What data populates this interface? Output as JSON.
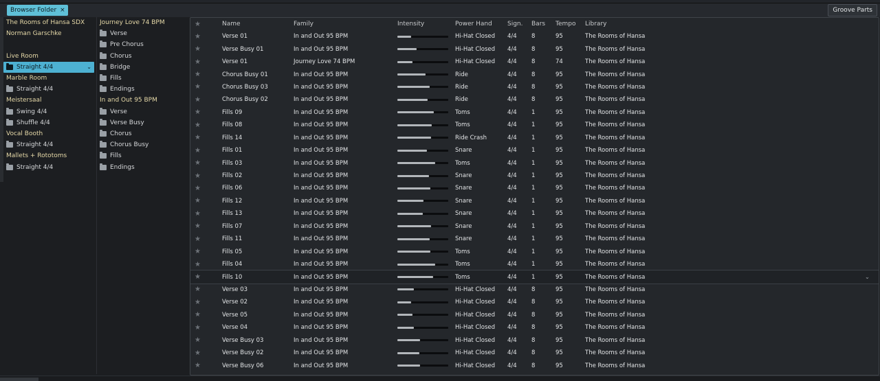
{
  "topbar": {
    "chip_label": "Browser Folder",
    "chip_close": "×",
    "groove_button": "Groove Parts"
  },
  "left_tree": [
    {
      "type": "head",
      "label": "The Rooms of Hansa SDX"
    },
    {
      "type": "head",
      "label": "Norman Garschke"
    },
    {
      "type": "spacer"
    },
    {
      "type": "head",
      "label": "Live Room"
    },
    {
      "type": "folder",
      "label": "Straight 4/4",
      "selected": true
    },
    {
      "type": "head",
      "label": "Marble Room"
    },
    {
      "type": "folder",
      "label": "Straight 4/4"
    },
    {
      "type": "head",
      "label": "Meistersaal"
    },
    {
      "type": "folder",
      "label": "Swing 4/4"
    },
    {
      "type": "folder",
      "label": "Shuffle 4/4"
    },
    {
      "type": "head",
      "label": "Vocal Booth"
    },
    {
      "type": "folder",
      "label": "Straight 4/4"
    },
    {
      "type": "head",
      "label": "Mallets + Rototoms"
    },
    {
      "type": "folder",
      "label": "Straight 4/4"
    }
  ],
  "mid_tree": [
    {
      "type": "head",
      "label": "Journey Love 74 BPM"
    },
    {
      "type": "folder",
      "label": "Verse"
    },
    {
      "type": "folder",
      "label": "Pre Chorus"
    },
    {
      "type": "folder",
      "label": "Chorus"
    },
    {
      "type": "folder",
      "label": "Bridge"
    },
    {
      "type": "folder",
      "label": "Fills"
    },
    {
      "type": "folder",
      "label": "Endings"
    },
    {
      "type": "head",
      "label": "In and Out 95 BPM"
    },
    {
      "type": "folder",
      "label": "Verse"
    },
    {
      "type": "folder",
      "label": "Verse Busy"
    },
    {
      "type": "folder",
      "label": "Chorus"
    },
    {
      "type": "folder",
      "label": "Chorus Busy"
    },
    {
      "type": "folder",
      "label": "Fills"
    },
    {
      "type": "folder",
      "label": "Endings"
    }
  ],
  "table": {
    "columns": {
      "star": "★",
      "name": "Name",
      "family": "Family",
      "intensity": "Intensity",
      "power_hand": "Power Hand",
      "sign": "Sign.",
      "bars": "Bars",
      "tempo": "Tempo",
      "library": "Library"
    },
    "rows": [
      {
        "name": "Verse 01",
        "family": "In and Out 95 BPM",
        "intensity": 0.27,
        "power_hand": "Hi-Hat Closed",
        "sign": "4/4",
        "bars": "8",
        "tempo": "95",
        "library": "The Rooms of Hansa"
      },
      {
        "name": "Verse Busy 01",
        "family": "In and Out 95 BPM",
        "intensity": 0.38,
        "power_hand": "Hi-Hat Closed",
        "sign": "4/4",
        "bars": "8",
        "tempo": "95",
        "library": "The Rooms of Hansa"
      },
      {
        "name": "Verse 01",
        "family": "Journey Love 74 BPM",
        "intensity": 0.3,
        "power_hand": "Hi-Hat Closed",
        "sign": "4/4",
        "bars": "8",
        "tempo": "74",
        "library": "The Rooms of Hansa"
      },
      {
        "name": "Chorus Busy 01",
        "family": "In and Out 95 BPM",
        "intensity": 0.55,
        "power_hand": "Ride",
        "sign": "4/4",
        "bars": "8",
        "tempo": "95",
        "library": "The Rooms of Hansa"
      },
      {
        "name": "Chorus Busy 03",
        "family": "In and Out 95 BPM",
        "intensity": 0.64,
        "power_hand": "Ride",
        "sign": "4/4",
        "bars": "8",
        "tempo": "95",
        "library": "The Rooms of Hansa"
      },
      {
        "name": "Chorus Busy 02",
        "family": "In and Out 95 BPM",
        "intensity": 0.6,
        "power_hand": "Ride",
        "sign": "4/4",
        "bars": "8",
        "tempo": "95",
        "library": "The Rooms of Hansa"
      },
      {
        "name": "Fills 09",
        "family": "In and Out 95 BPM",
        "intensity": 0.72,
        "power_hand": "Toms",
        "sign": "4/4",
        "bars": "1",
        "tempo": "95",
        "library": "The Rooms of Hansa"
      },
      {
        "name": "Fills 08",
        "family": "In and Out 95 BPM",
        "intensity": 0.68,
        "power_hand": "Toms",
        "sign": "4/4",
        "bars": "1",
        "tempo": "95",
        "library": "The Rooms of Hansa"
      },
      {
        "name": "Fills 14",
        "family": "In and Out 95 BPM",
        "intensity": 0.66,
        "power_hand": "Ride Crash",
        "sign": "4/4",
        "bars": "1",
        "tempo": "95",
        "library": "The Rooms of Hansa"
      },
      {
        "name": "Fills 01",
        "family": "In and Out 95 BPM",
        "intensity": 0.58,
        "power_hand": "Snare",
        "sign": "4/4",
        "bars": "1",
        "tempo": "95",
        "library": "The Rooms of Hansa"
      },
      {
        "name": "Fills 03",
        "family": "In and Out 95 BPM",
        "intensity": 0.74,
        "power_hand": "Toms",
        "sign": "4/4",
        "bars": "1",
        "tempo": "95",
        "library": "The Rooms of Hansa"
      },
      {
        "name": "Fills 02",
        "family": "In and Out 95 BPM",
        "intensity": 0.62,
        "power_hand": "Snare",
        "sign": "4/4",
        "bars": "1",
        "tempo": "95",
        "library": "The Rooms of Hansa"
      },
      {
        "name": "Fills 06",
        "family": "In and Out 95 BPM",
        "intensity": 0.65,
        "power_hand": "Snare",
        "sign": "4/4",
        "bars": "1",
        "tempo": "95",
        "library": "The Rooms of Hansa"
      },
      {
        "name": "Fills 12",
        "family": "In and Out 95 BPM",
        "intensity": 0.52,
        "power_hand": "Snare",
        "sign": "4/4",
        "bars": "1",
        "tempo": "95",
        "library": "The Rooms of Hansa"
      },
      {
        "name": "Fills 13",
        "family": "In and Out 95 BPM",
        "intensity": 0.5,
        "power_hand": "Snare",
        "sign": "4/4",
        "bars": "1",
        "tempo": "95",
        "library": "The Rooms of Hansa"
      },
      {
        "name": "Fills 07",
        "family": "In and Out 95 BPM",
        "intensity": 0.66,
        "power_hand": "Snare",
        "sign": "4/4",
        "bars": "1",
        "tempo": "95",
        "library": "The Rooms of Hansa"
      },
      {
        "name": "Fills 11",
        "family": "In and Out 95 BPM",
        "intensity": 0.64,
        "power_hand": "Snare",
        "sign": "4/4",
        "bars": "1",
        "tempo": "95",
        "library": "The Rooms of Hansa"
      },
      {
        "name": "Fills 05",
        "family": "In and Out 95 BPM",
        "intensity": 0.65,
        "power_hand": "Toms",
        "sign": "4/4",
        "bars": "1",
        "tempo": "95",
        "library": "The Rooms of Hansa"
      },
      {
        "name": "Fills 04",
        "family": "In and Out 95 BPM",
        "intensity": 0.74,
        "power_hand": "Toms",
        "sign": "4/4",
        "bars": "1",
        "tempo": "95",
        "library": "The Rooms of Hansa"
      },
      {
        "name": "Fills 10",
        "family": "In and Out 95 BPM",
        "intensity": 0.7,
        "power_hand": "Toms",
        "sign": "4/4",
        "bars": "1",
        "tempo": "95",
        "library": "The Rooms of Hansa",
        "highlight": true
      },
      {
        "name": "Verse 03",
        "family": "In and Out 95 BPM",
        "intensity": 0.32,
        "power_hand": "Hi-Hat Closed",
        "sign": "4/4",
        "bars": "8",
        "tempo": "95",
        "library": "The Rooms of Hansa"
      },
      {
        "name": "Verse 02",
        "family": "In and Out 95 BPM",
        "intensity": 0.27,
        "power_hand": "Hi-Hat Closed",
        "sign": "4/4",
        "bars": "8",
        "tempo": "95",
        "library": "The Rooms of Hansa"
      },
      {
        "name": "Verse 05",
        "family": "In and Out 95 BPM",
        "intensity": 0.3,
        "power_hand": "Hi-Hat Closed",
        "sign": "4/4",
        "bars": "8",
        "tempo": "95",
        "library": "The Rooms of Hansa"
      },
      {
        "name": "Verse 04",
        "family": "In and Out 95 BPM",
        "intensity": 0.32,
        "power_hand": "Hi-Hat Closed",
        "sign": "4/4",
        "bars": "8",
        "tempo": "95",
        "library": "The Rooms of Hansa"
      },
      {
        "name": "Verse Busy 03",
        "family": "In and Out 95 BPM",
        "intensity": 0.44,
        "power_hand": "Hi-Hat Closed",
        "sign": "4/4",
        "bars": "8",
        "tempo": "95",
        "library": "The Rooms of Hansa"
      },
      {
        "name": "Verse Busy 02",
        "family": "In and Out 95 BPM",
        "intensity": 0.43,
        "power_hand": "Hi-Hat Closed",
        "sign": "4/4",
        "bars": "8",
        "tempo": "95",
        "library": "The Rooms of Hansa"
      },
      {
        "name": "Verse Busy 06",
        "family": "In and Out 95 BPM",
        "intensity": 0.44,
        "power_hand": "Hi-Hat Closed",
        "sign": "4/4",
        "bars": "8",
        "tempo": "95",
        "library": "The Rooms of Hansa"
      }
    ]
  },
  "icons": {
    "star": "★",
    "chevron": "⌄",
    "folder": "folder-icon"
  }
}
